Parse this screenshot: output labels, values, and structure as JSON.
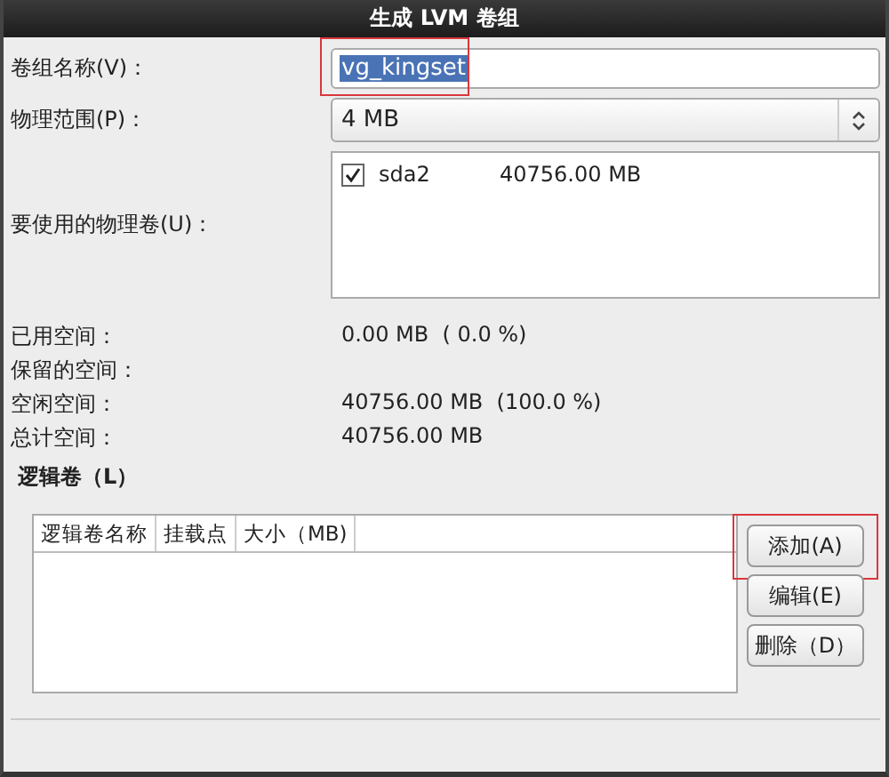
{
  "window": {
    "title": "生成 LVM 卷组"
  },
  "fields": [
    {
      "kind": "text",
      "label": "卷组名称(V)：",
      "value": "vg_kingset",
      "text_selected": true,
      "highlighted": true
    },
    {
      "kind": "select",
      "label": "物理范围(P)：",
      "value": "4 MB"
    }
  ],
  "physical_volumes": {
    "label": "要使用的物理卷(U)：",
    "items": [
      {
        "name": "sda2",
        "size": "40756.00 MB",
        "checked": true
      }
    ]
  },
  "stats": [
    {
      "label": "已用空间：",
      "value": "0.00 MB  ( 0.0 %)"
    },
    {
      "label": "保留的空间："
    },
    {
      "label": "空闲空间：",
      "value": "40756.00 MB  (100.0 %)"
    },
    {
      "label": "总计空间：",
      "value": "40756.00 MB"
    }
  ],
  "logical_volumes": {
    "title": "逻辑卷（L）",
    "columns": [
      "逻辑卷名称",
      "挂载点",
      "大小（MB)"
    ],
    "buttons": [
      {
        "label": "添加(A)",
        "highlighted": true
      },
      {
        "label": "编辑(E)",
        "highlighted": false
      },
      {
        "label": "删除（D）",
        "highlighted": false
      }
    ]
  }
}
